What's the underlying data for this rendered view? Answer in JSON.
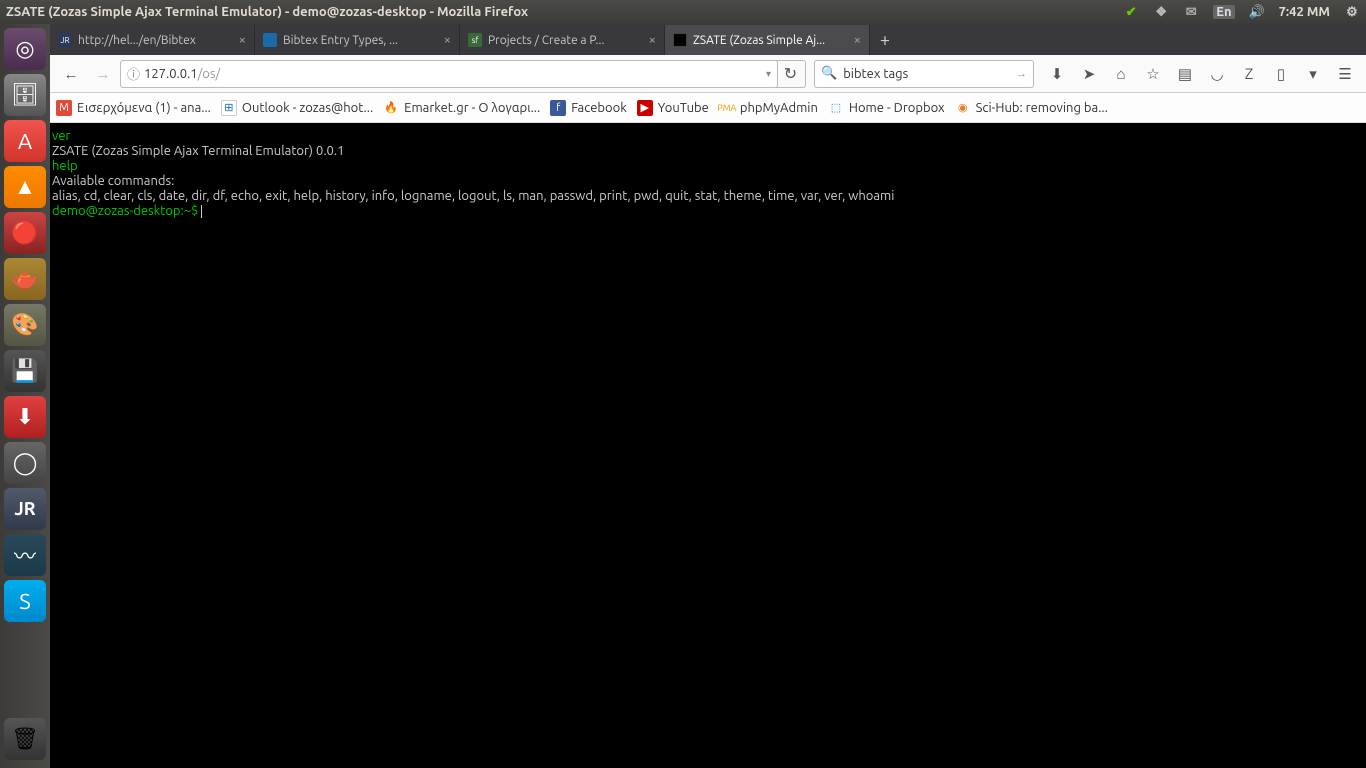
{
  "titlebar": {
    "title": "ZSATE (Zozas Simple Ajax Terminal Emulator) - demo@zozas-desktop - Mozilla Firefox",
    "lang": "En",
    "time": "7:42 MM"
  },
  "tabs": [
    {
      "title": "http://hel.../en/Bibtex",
      "favicon_bg": "#2a3a5a",
      "favicon_text": "JR"
    },
    {
      "title": "Bibtex Entry Types, ...",
      "favicon_bg": "#1a6aaa",
      "favicon_text": ""
    },
    {
      "title": "Projects / Create a P...",
      "favicon_bg": "#3a6a3a",
      "favicon_text": "sf"
    },
    {
      "title": "ZSATE (Zozas Simple Aj...",
      "favicon_bg": "#000",
      "favicon_text": ""
    }
  ],
  "url": {
    "host": "127.0.0.1",
    "path": "/os/"
  },
  "search": {
    "value": "bibtex tags"
  },
  "bookmarks": [
    {
      "label": "Εισερχόμενα (1) - ana...",
      "bg": "#e04a3a",
      "glyph": "M"
    },
    {
      "label": "Outlook - zozas@hot...",
      "bg": "#ffffff",
      "glyph": "⊞"
    },
    {
      "label": "Emarket.gr - Ο λογαρι...",
      "bg": "#d97706",
      "glyph": "🔥"
    },
    {
      "label": "Facebook",
      "bg": "#3b5998",
      "glyph": "f"
    },
    {
      "label": "YouTube",
      "bg": "#cc0000",
      "glyph": "▶"
    },
    {
      "label": "phpMyAdmin",
      "bg": "#f89406",
      "glyph": "P"
    },
    {
      "label": "Home - Dropbox",
      "bg": "#007ee5",
      "glyph": "⬚"
    },
    {
      "label": "Sci-Hub: removing ba...",
      "bg": "#e67e22",
      "glyph": "◉"
    }
  ],
  "terminal": {
    "cmd1": "ver",
    "out1": "ZSATE (Zozas Simple Ajax Terminal Emulator) 0.0.1",
    "cmd2": "help",
    "out2a": "Available commands:",
    "out2b": "alias, cd, clear, cls, date, dir, df, echo, exit, help, history, info, logname, logout, ls, man, passwd, print, pwd, quit, stat, theme, time, var, ver, whoami",
    "prompt": "demo@zozas-desktop:~$ "
  }
}
